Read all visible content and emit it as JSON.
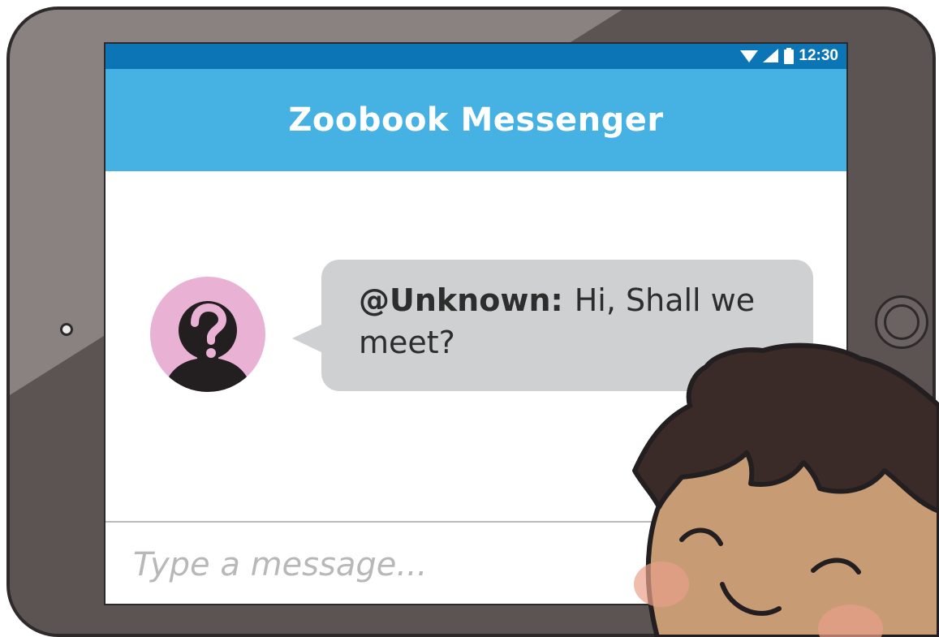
{
  "status_bar": {
    "time": "12:30",
    "icons": [
      "wifi-icon",
      "signal-icon",
      "battery-icon"
    ],
    "color": "#0c75b5"
  },
  "app": {
    "title": "Zoobook Messenger",
    "header_color": "#46b1e3"
  },
  "conversation": {
    "messages": [
      {
        "sender": "@Unknown:",
        "text": "Hi, Shall we meet?",
        "avatar_icon": "question-mark-icon",
        "bubble_color": "#cfd0d2"
      }
    ]
  },
  "composer": {
    "placeholder": "Type a message..."
  },
  "device": {
    "frame_color": "#5b5452"
  }
}
